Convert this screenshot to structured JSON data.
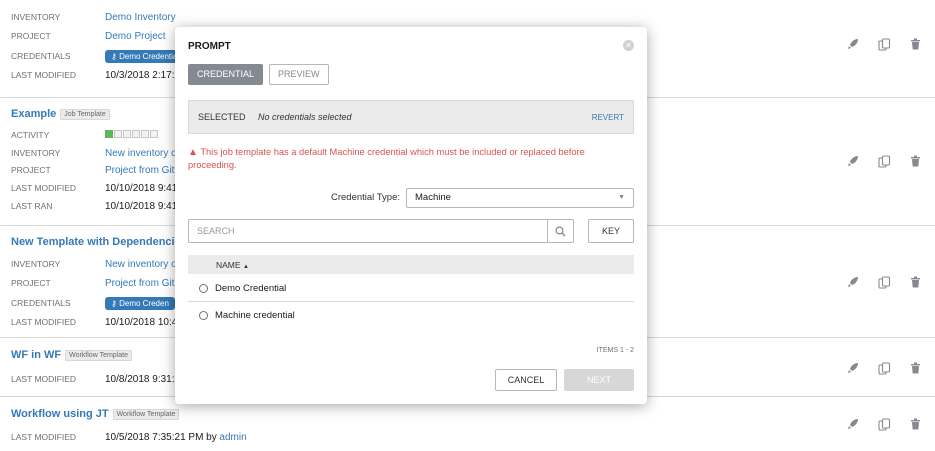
{
  "cards": [
    {
      "title": "",
      "tag": "",
      "rows": [
        {
          "label": "INVENTORY",
          "value": "Demo Inventory",
          "link": true
        },
        {
          "label": "PROJECT",
          "value": "Demo Project",
          "link": true
        },
        {
          "label": "CREDENTIALS",
          "value": "Demo Credential",
          "chip": true
        },
        {
          "label": "LAST MODIFIED",
          "value": "10/3/2018 2:17:",
          "link": false
        }
      ]
    },
    {
      "title": "Example",
      "tag": "Job Template",
      "rows": [
        {
          "label": "ACTIVITY",
          "activity": true
        },
        {
          "label": "INVENTORY",
          "value": "New inventory o",
          "link": true
        },
        {
          "label": "PROJECT",
          "value": "Project from Git",
          "link": true
        },
        {
          "label": "LAST MODIFIED",
          "value": "10/10/2018 9:41",
          "link": false
        },
        {
          "label": "LAST RAN",
          "value": "10/10/2018 9:41",
          "link": false
        }
      ]
    },
    {
      "title": "New Template with Dependenci",
      "tag": "",
      "rows": [
        {
          "label": "INVENTORY",
          "value": "New inventory o",
          "link": true
        },
        {
          "label": "PROJECT",
          "value": "Project from Git",
          "link": true
        },
        {
          "label": "CREDENTIALS",
          "value": "Demo Creden",
          "chip": true
        },
        {
          "label": "LAST MODIFIED",
          "value": "10/10/2018 10:4",
          "link": false
        }
      ]
    },
    {
      "title": "WF in WF",
      "tag": "Workflow Template",
      "rows": [
        {
          "label": "LAST MODIFIED",
          "value": "10/8/2018 9:31:",
          "link": false
        }
      ]
    },
    {
      "title": "Workflow using JT",
      "tag": "Workflow Template",
      "rows": [
        {
          "label": "LAST MODIFIED",
          "value": "10/5/2018 7:35:21 PM by",
          "link": false,
          "by": "admin"
        }
      ]
    }
  ],
  "modal": {
    "title": "PROMPT",
    "steps": [
      "CREDENTIAL",
      "PREVIEW"
    ],
    "selected_label": "SELECTED",
    "selected_value": "No credentials selected",
    "revert": "REVERT",
    "warning": "This job template has a default Machine credential which must be included or replaced before proceeding.",
    "credential_type_label": "Credential Type:",
    "credential_type_value": "Machine",
    "search_placeholder": "SEARCH",
    "key_label": "KEY",
    "column_name": "NAME",
    "rows": [
      "Demo Credential",
      "Machine credential"
    ],
    "items_count": "ITEMS  1 - 2",
    "cancel": "CANCEL",
    "next": "NEXT"
  },
  "colors": {
    "link": "#337ab7",
    "warning": "#d9534f",
    "active_step": "#848992"
  }
}
